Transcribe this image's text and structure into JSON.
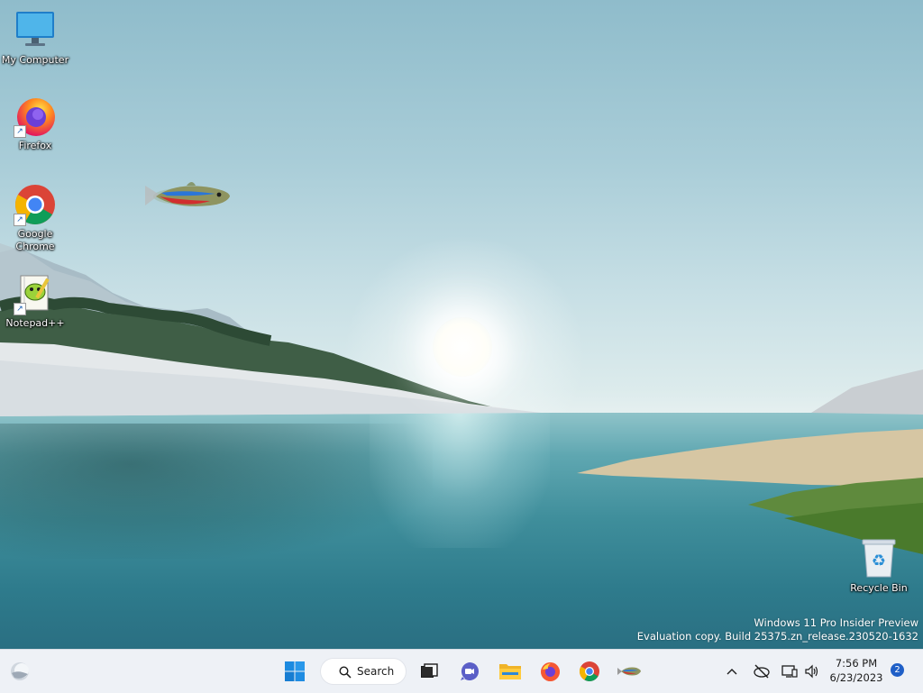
{
  "desktop": {
    "icons": [
      {
        "label": "My Computer",
        "icon": "monitor-icon"
      },
      {
        "label": "Firefox",
        "icon": "firefox-icon"
      },
      {
        "label": "Google Chrome",
        "icon": "chrome-icon"
      },
      {
        "label": "Notepad++",
        "icon": "notepad-plus-plus-icon"
      },
      {
        "label": "Recycle Bin",
        "icon": "recycle-bin-icon"
      }
    ],
    "watermark": {
      "line1": "Windows 11 Pro Insider Preview",
      "line2": "Evaluation copy. Build 25375.zn_release.230520-1632"
    }
  },
  "taskbar": {
    "search_label": "Search",
    "apps": [
      "widgets-icon",
      "start-icon",
      "search-icon",
      "task-view-icon",
      "teams-chat-icon",
      "file-explorer-icon",
      "firefox-icon",
      "chrome-icon",
      "fish-icon"
    ],
    "clock": {
      "time": "7:56 PM",
      "date": "6/23/2023"
    },
    "notification_count": "2",
    "tray_icons": [
      "chevron-up-icon",
      "network-disconnected-icon",
      "display-icon",
      "speaker-icon"
    ]
  },
  "colors": {
    "taskbar_bg": "#eef1f6",
    "accent": "#1f5fc7"
  }
}
